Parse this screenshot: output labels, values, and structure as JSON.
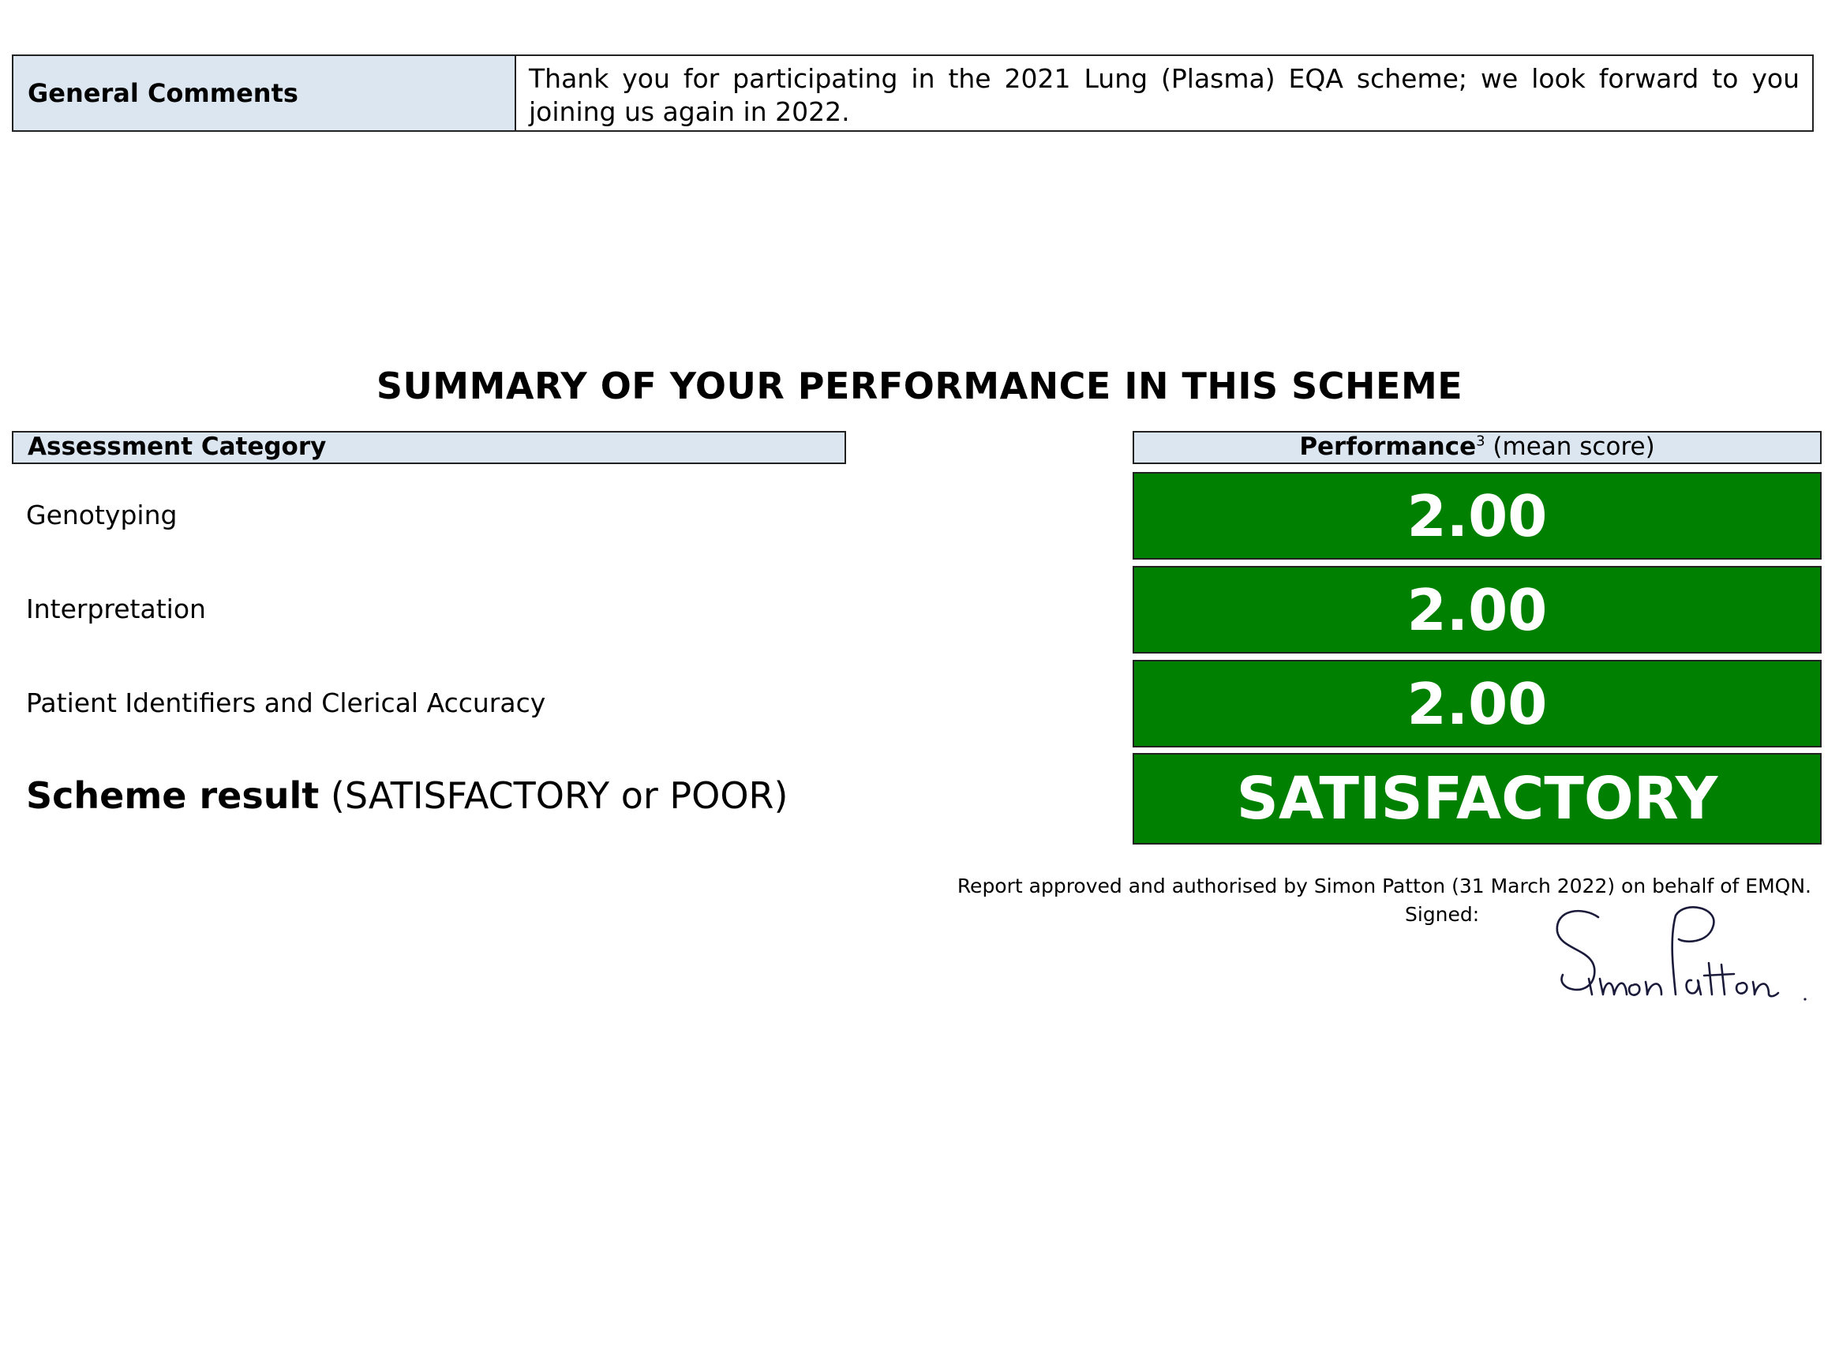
{
  "general_comments": {
    "label": "General Comments",
    "text": "Thank you for participating in the 2021 Lung (Plasma) EQA scheme; we look forward to you joining us again in 2022."
  },
  "summary": {
    "heading": "SUMMARY OF YOUR PERFORMANCE IN THIS SCHEME",
    "header_left": "Assessment Category",
    "header_right_bold": "Performance",
    "header_right_sup": "3",
    "header_right_rest": " (mean score)",
    "rows": [
      {
        "category": "Genotyping",
        "score": "2.00"
      },
      {
        "category": "Interpretation",
        "score": "2.00"
      },
      {
        "category": "Patient Identifiers and Clerical Accuracy",
        "score": "2.00"
      }
    ],
    "scheme_result_label_bold": "Scheme result",
    "scheme_result_label_rest": " (SATISFACTORY or POOR)",
    "scheme_result_value": "SATISFACTORY",
    "result_color": "#008000"
  },
  "approval": {
    "text": "Report approved and authorised by Simon Patton (31 March 2022) on behalf of EMQN.",
    "signed_label": "Signed:",
    "signature": "Simon Patton"
  }
}
